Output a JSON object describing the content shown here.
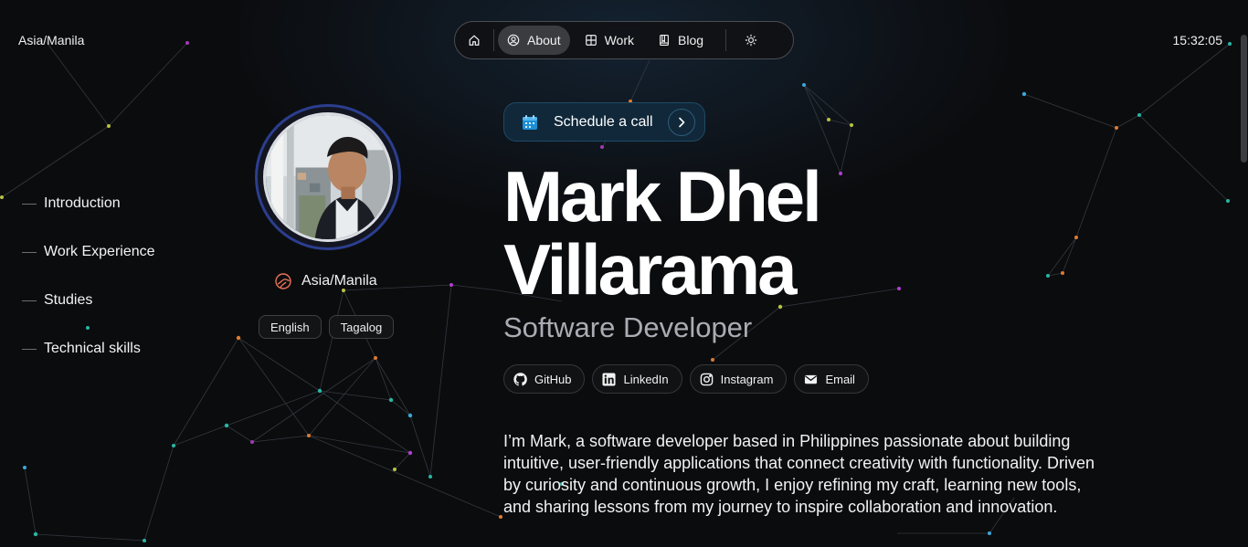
{
  "header": {
    "timezone": "Asia/Manila",
    "clock": "15:32:05"
  },
  "nav": {
    "items": [
      {
        "label": "About",
        "icon": "user-circle-icon",
        "active": true
      },
      {
        "label": "Work",
        "icon": "grid-icon",
        "active": false
      },
      {
        "label": "Blog",
        "icon": "book-icon",
        "active": false
      }
    ]
  },
  "toc": {
    "items": [
      "Introduction",
      "Work Experience",
      "Studies",
      "Technical skills"
    ]
  },
  "profile": {
    "location": "Asia/Manila",
    "languages": [
      "English",
      "Tagalog"
    ]
  },
  "hero": {
    "schedule_label": "Schedule a call",
    "name": "Mark Dhel Villarama",
    "role": "Software Developer",
    "socials": [
      {
        "label": "GitHub",
        "icon": "github-icon"
      },
      {
        "label": "LinkedIn",
        "icon": "linkedin-icon"
      },
      {
        "label": "Instagram",
        "icon": "instagram-icon"
      },
      {
        "label": "Email",
        "icon": "email-icon"
      }
    ],
    "bio": "I’m Mark, a software developer based in Philippines passionate about building intuitive, user-friendly applications that connect creativity with functionality. Driven by curiosity and continuous growth, I enjoy refining my craft, learning new tools, and sharing lessons from my journey to inspire collaboration and innovation."
  },
  "colors": {
    "background": "#0b0c0e",
    "accent": "#10283a",
    "avatar_ring": "#2b3e8f",
    "location_icon": "#e8735a"
  }
}
